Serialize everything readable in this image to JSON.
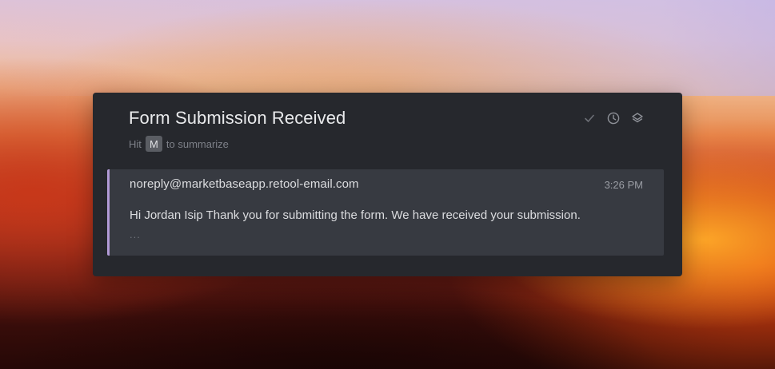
{
  "notification": {
    "title": "Form Submission Received",
    "hint": {
      "prefix": "Hit",
      "key": "M",
      "suffix": "to summarize"
    },
    "actions": [
      {
        "name": "mark-done",
        "icon": "check-icon"
      },
      {
        "name": "snooze",
        "icon": "clock-icon"
      },
      {
        "name": "archive",
        "icon": "layers-icon"
      }
    ],
    "message": {
      "sender": "noreply@marketbaseapp.retool-email.com",
      "time": "3:26 PM",
      "body": "Hi Jordan Isip Thank you for submitting the form. We have received your submission.",
      "more": "..."
    }
  },
  "colors": {
    "panel_bg": "#26282d",
    "message_bg": "#373a41",
    "accent_border": "#b29ad6",
    "text_primary": "#e9eaec",
    "text_muted": "#7d8088"
  }
}
